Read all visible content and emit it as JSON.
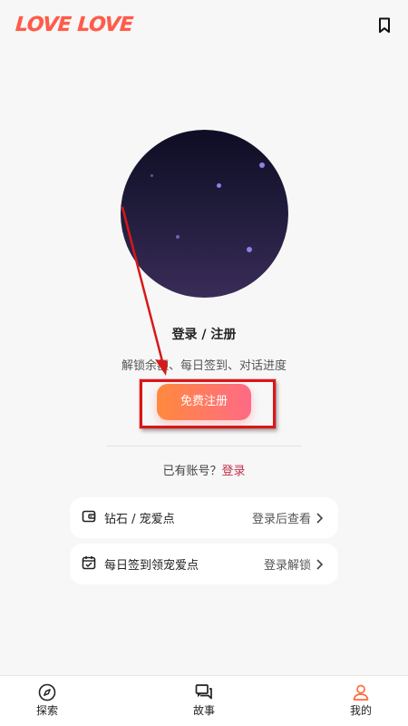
{
  "app": {
    "logo_text": "LOVE LOVE",
    "accent_color": "#ff5b4a"
  },
  "header": {
    "bookmark_icon": "bookmark-icon"
  },
  "profile": {
    "title": "登录 / 注册",
    "subtitle": "解锁余额、每日签到、对话进度",
    "register_button": "免费注册",
    "has_account_text": "已有账号？",
    "login_link": "登录"
  },
  "cards": [
    {
      "icon": "wallet-icon",
      "label": "钻石 / 宠爱点",
      "status": "登录后查看"
    },
    {
      "icon": "calendar-check-icon",
      "label": "每日签到领宠爱点",
      "status": "登录解锁"
    }
  ],
  "nav": {
    "items": [
      {
        "icon": "compass-icon",
        "label": "探索"
      },
      {
        "icon": "chat-icon",
        "label": "故事"
      },
      {
        "icon": "user-icon",
        "label": "我的",
        "active": true
      }
    ],
    "active_color": "#ff6b3d"
  }
}
